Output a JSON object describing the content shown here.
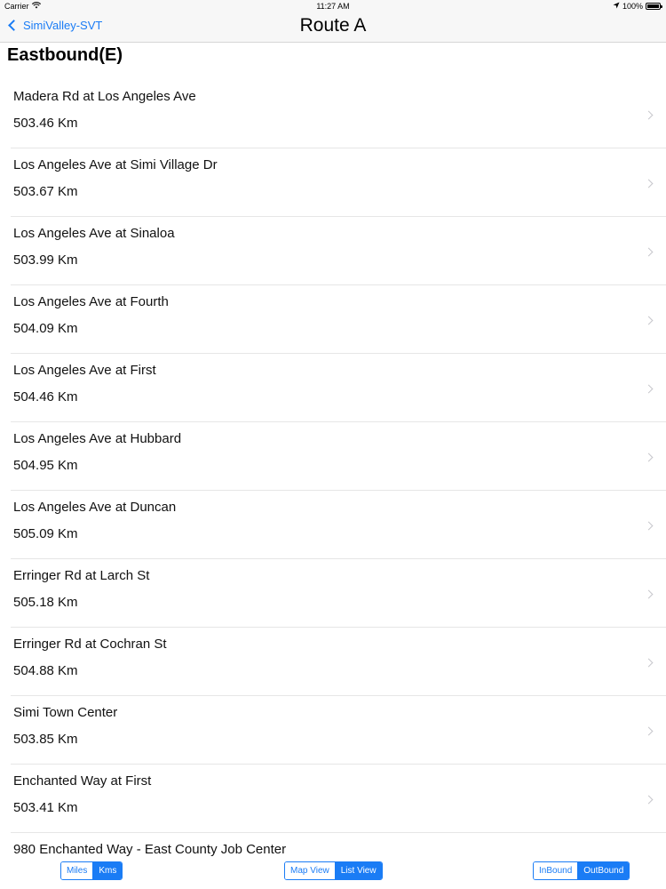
{
  "status_bar": {
    "carrier": "Carrier",
    "time": "11:27 AM",
    "battery": "100%",
    "battery_level": 1.0
  },
  "nav": {
    "back_label": "SimiValley-SVT",
    "title": "Route A"
  },
  "section": {
    "title": "Eastbound(E)"
  },
  "stops": [
    {
      "name": "Madera Rd at Los Angeles Ave",
      "distance": "503.46 Km"
    },
    {
      "name": "Los Angeles Ave at Simi Village Dr",
      "distance": "503.67 Km"
    },
    {
      "name": "Los Angeles Ave at Sinaloa",
      "distance": "503.99 Km"
    },
    {
      "name": "Los Angeles Ave at Fourth",
      "distance": "504.09 Km"
    },
    {
      "name": "Los Angeles Ave at First",
      "distance": "504.46 Km"
    },
    {
      "name": "Los Angeles Ave at Hubbard",
      "distance": "504.95 Km"
    },
    {
      "name": "Los Angeles Ave at Duncan",
      "distance": "505.09 Km"
    },
    {
      "name": "Erringer Rd at Larch St",
      "distance": "505.18 Km"
    },
    {
      "name": "Erringer Rd at Cochran St",
      "distance": "504.88 Km"
    },
    {
      "name": "Simi Town Center",
      "distance": "503.85 Km"
    },
    {
      "name": "Enchanted Way at First",
      "distance": "503.41 Km"
    },
    {
      "name": "980 Enchanted Way - East County Job Center",
      "distance": ""
    }
  ],
  "controls": {
    "units": {
      "options": [
        "Miles",
        "Kms"
      ],
      "selected": "Kms"
    },
    "view": {
      "options": [
        "Map View",
        "List View"
      ],
      "selected": "List View"
    },
    "direction": {
      "options": [
        "InBound",
        "OutBound"
      ],
      "selected": "OutBound"
    }
  },
  "colors": {
    "accent": "#1a7cf5",
    "separator": "#e6e6e6",
    "bar_background": "#f7f7f7"
  }
}
